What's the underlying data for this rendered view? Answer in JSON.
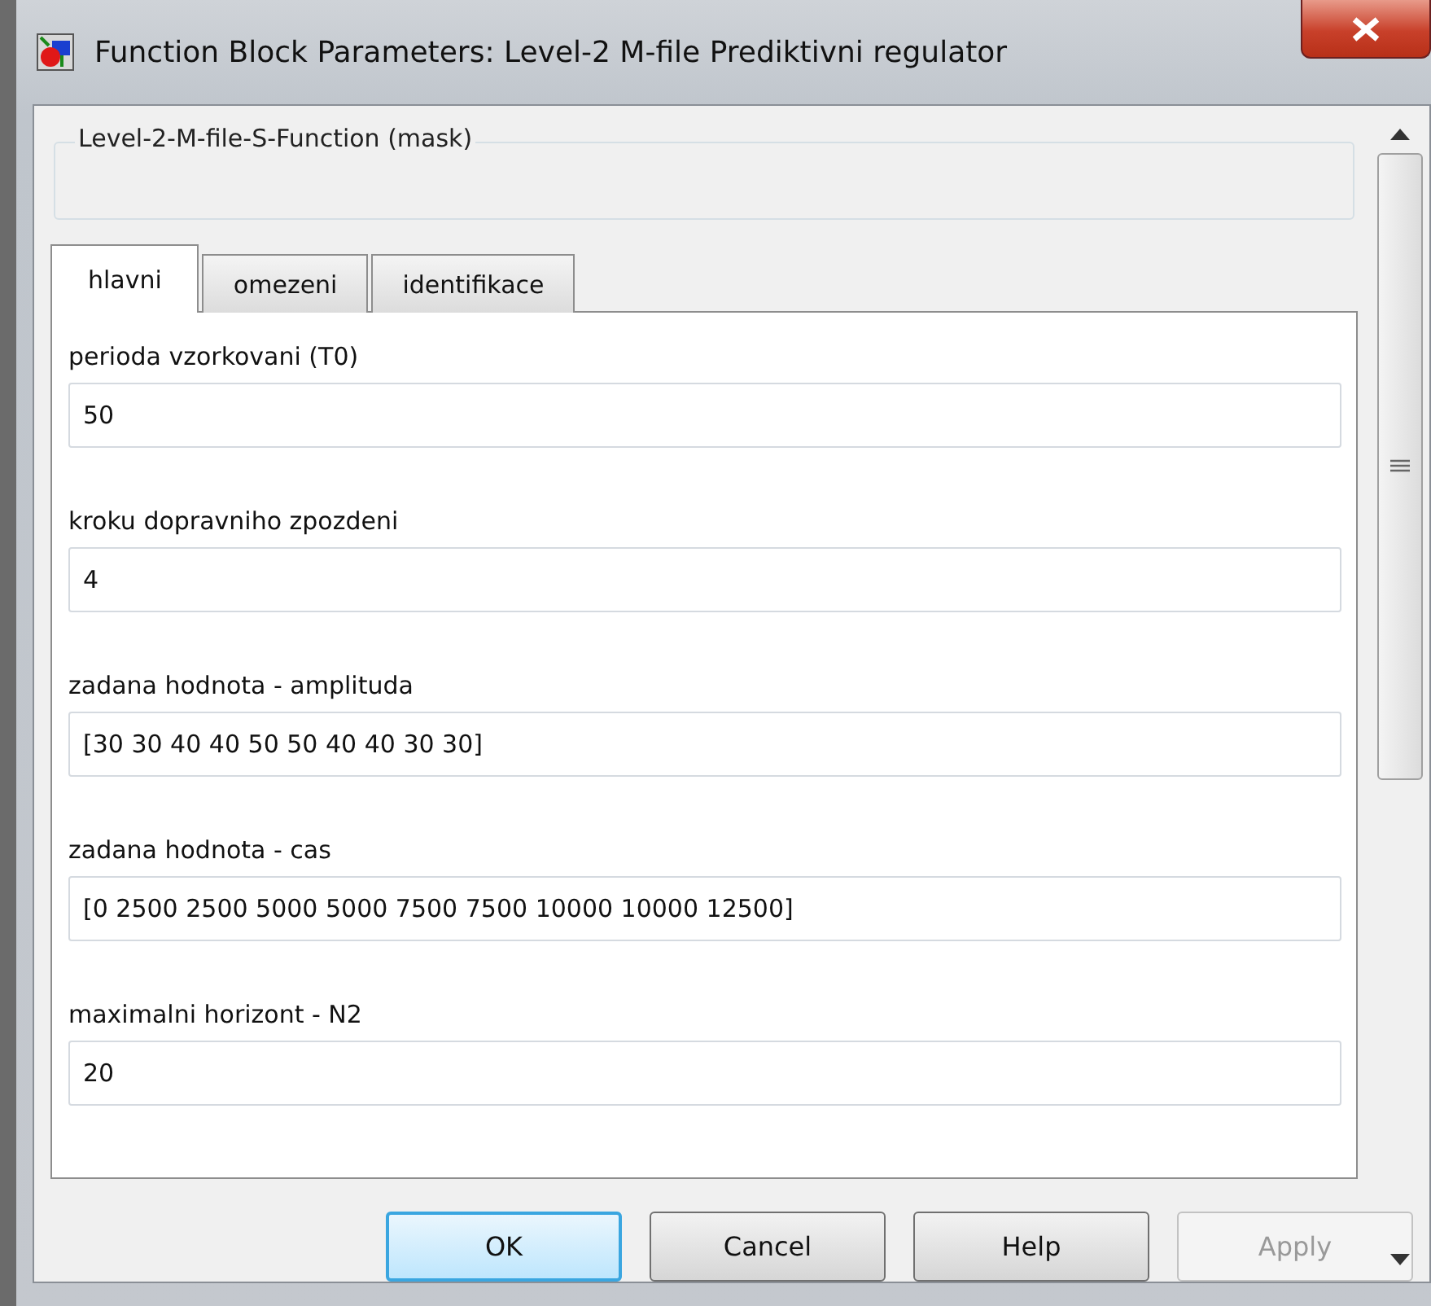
{
  "window": {
    "title": "Function Block Parameters: Level-2 M-file Prediktivni regulator"
  },
  "group": {
    "title": "Level-2-M-file-S-Function (mask)"
  },
  "tabs": [
    {
      "label": "hlavni",
      "selected": true
    },
    {
      "label": "omezeni",
      "selected": false
    },
    {
      "label": "identifikace",
      "selected": false
    }
  ],
  "parameters": [
    {
      "label": "perioda vzorkovani (T0)",
      "value": "50"
    },
    {
      "label": "kroku dopravniho zpozdeni",
      "value": "4"
    },
    {
      "label": "zadana hodnota - amplituda",
      "value": "[30 30 40 40 50 50 40 40 30 30]"
    },
    {
      "label": "zadana hodnota - cas",
      "value": "[0 2500 2500 5000 5000 7500 7500 10000 10000 12500]"
    },
    {
      "label": "maximalni horizont - N2",
      "value": "20"
    }
  ],
  "buttons": [
    {
      "label": "OK",
      "default": true,
      "disabled": false
    },
    {
      "label": "Cancel",
      "default": false,
      "disabled": false
    },
    {
      "label": "Help",
      "default": false,
      "disabled": false
    },
    {
      "label": "Apply",
      "default": false,
      "disabled": true
    }
  ]
}
